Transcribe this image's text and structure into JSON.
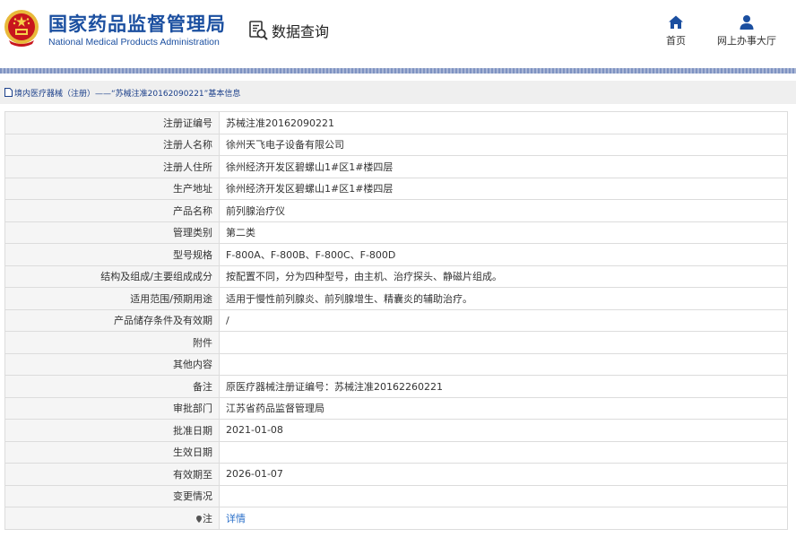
{
  "header": {
    "logo_cn": "国家药品监督管理局",
    "logo_en": "National Medical Products Administration",
    "data_query": "数据查询",
    "nav": [
      {
        "label": "首页",
        "icon": "home-icon"
      },
      {
        "label": "网上办事大厅",
        "icon": "user-icon"
      }
    ]
  },
  "breadcrumb": "境内医疗器械（注册）——“苏械注准20162090221”基本信息",
  "records": [
    {
      "label": "注册证编号",
      "value": "苏械注准20162090221"
    },
    {
      "label": "注册人名称",
      "value": "徐州天飞电子设备有限公司"
    },
    {
      "label": "注册人住所",
      "value": "徐州经济开发区碧螺山1#区1#楼四层"
    },
    {
      "label": "生产地址",
      "value": "徐州经济开发区碧螺山1#区1#楼四层"
    },
    {
      "label": "产品名称",
      "value": "前列腺治疗仪"
    },
    {
      "label": "管理类别",
      "value": "第二类"
    },
    {
      "label": "型号规格",
      "value": "F-800A、F-800B、F-800C、F-800D"
    },
    {
      "label": "结构及组成/主要组成成分",
      "value": "按配置不同，分为四种型号，由主机、治疗探头、静磁片组成。"
    },
    {
      "label": "适用范围/预期用途",
      "value": "适用于慢性前列腺炎、前列腺增生、精囊炎的辅助治疗。"
    },
    {
      "label": "产品储存条件及有效期",
      "value": "/"
    },
    {
      "label": "附件",
      "value": ""
    },
    {
      "label": "其他内容",
      "value": ""
    },
    {
      "label": "备注",
      "value": "原医疗器械注册证编号：苏械注准20162260221"
    },
    {
      "label": "审批部门",
      "value": "江苏省药品监督管理局"
    },
    {
      "label": "批准日期",
      "value": "2021-01-08"
    },
    {
      "label": "生效日期",
      "value": ""
    },
    {
      "label": "有效期至",
      "value": "2026-01-07"
    },
    {
      "label": "变更情况",
      "value": ""
    },
    {
      "label": "注",
      "value": "详情",
      "link": true
    }
  ],
  "colors": {
    "brand": "#1b4fa0",
    "link": "#2a6fc9",
    "label_bg": "#f5f5f5",
    "emblem_red": "#c8161d",
    "emblem_gold": "#e8b93a"
  }
}
